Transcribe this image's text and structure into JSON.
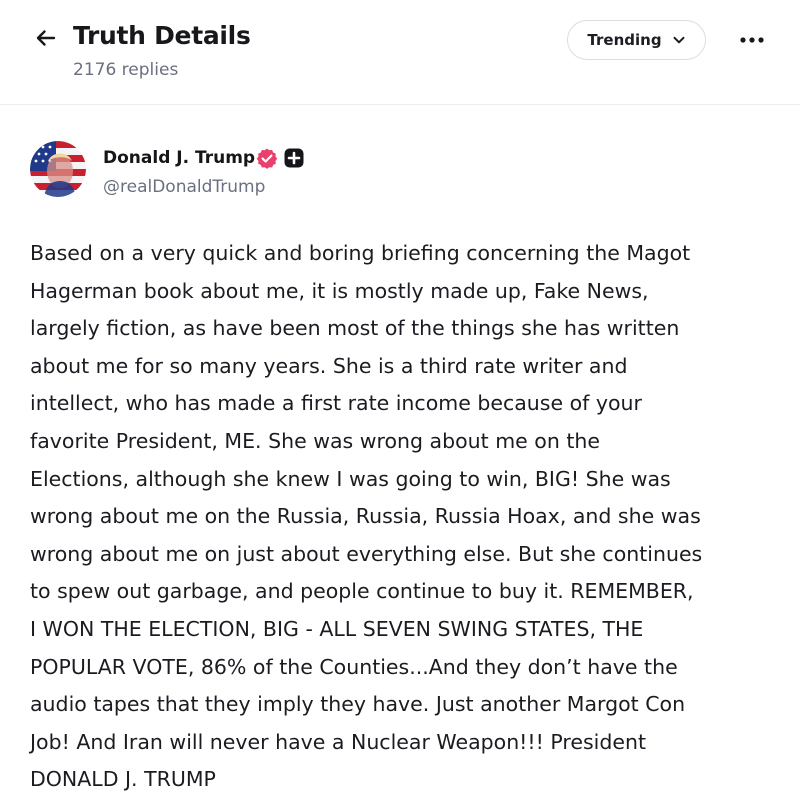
{
  "header": {
    "title": "Truth Details",
    "replies": "2176 replies",
    "sort_label": "Trending",
    "back_icon": "arrow-left-icon",
    "sort_icon": "chevron-down-icon",
    "more_icon": "ellipsis-icon"
  },
  "post": {
    "author_name": "Donald J. Trump",
    "author_handle": "@realDonaldTrump",
    "verified_icon": "verified-badge-icon",
    "plus_icon": "plus-badge-icon",
    "body_lines": [
      "Based on a very quick and boring briefing concerning the Magot",
      "Hagerman book about me, it is mostly made up, Fake News,",
      "largely fiction, as have been most of the things she has written",
      "about me for so many years. She is a third rate writer and",
      "intellect, who has made a first rate income because of your",
      "favorite President, ME. She was wrong about me on the",
      "Elections, although she knew I was going to win, BIG! She was",
      "wrong about me on the Russia, Russia, Russia Hoax, and she was",
      "wrong about me on just about everything else. But she continues",
      "to spew out garbage, and people continue to buy it. REMEMBER,",
      "I WON THE ELECTION, BIG - ALL SEVEN SWING STATES, THE",
      "POPULAR VOTE, 86% of the Counties...And they don’t have the",
      "audio tapes that they imply they have. Just another Margot Con",
      "Job! And Iran will never have a Nuclear Weapon!!! President",
      "DONALD J. TRUMP"
    ]
  },
  "colors": {
    "verified": "#e8416d",
    "text": "#1b1c21",
    "muted": "#6b7080",
    "border": "#dcdde3"
  }
}
